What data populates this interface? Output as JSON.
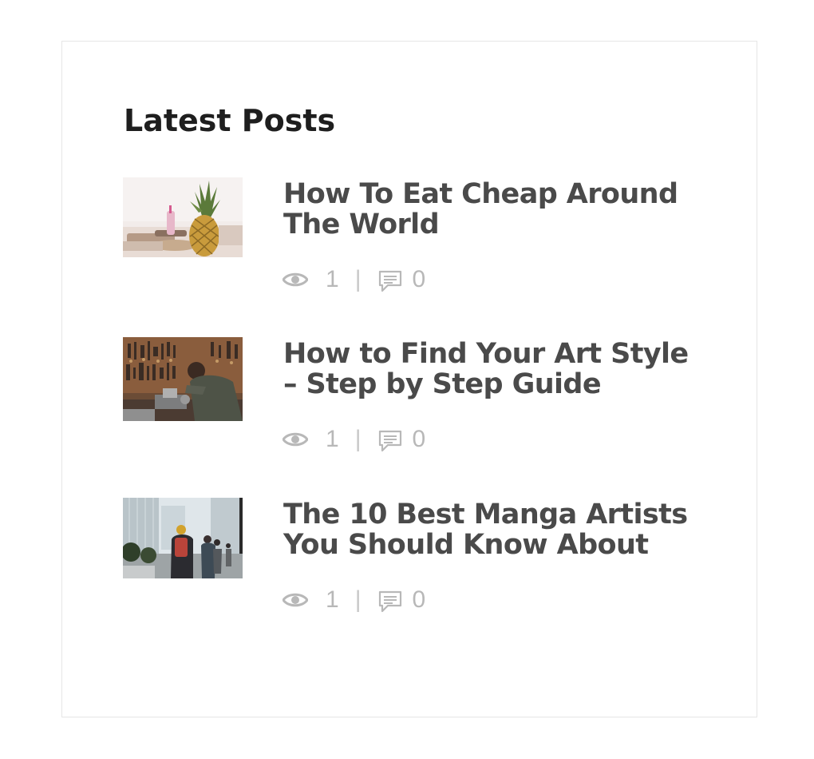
{
  "widget": {
    "title": "Latest Posts",
    "posts": [
      {
        "title": "How To Eat Cheap Around The World",
        "views": "1",
        "separator": "|",
        "comments": "0",
        "thumbnail": "pineapple-photo"
      },
      {
        "title": "How to Find Your Art Style – Step by Step Guide",
        "views": "1",
        "separator": "|",
        "comments": "0",
        "thumbnail": "workshop-photo"
      },
      {
        "title": "The 10 Best Manga Artists You Should Know About",
        "views": "1",
        "separator": "|",
        "comments": "0",
        "thumbnail": "city-street-photo"
      }
    ]
  },
  "colors": {
    "title": "#1e1e1e",
    "post_title": "#4a4a4a",
    "meta": "#b8b8b8",
    "border": "#e6e6e6"
  },
  "icons": {
    "views": "eye-icon",
    "comments": "comment-icon"
  }
}
